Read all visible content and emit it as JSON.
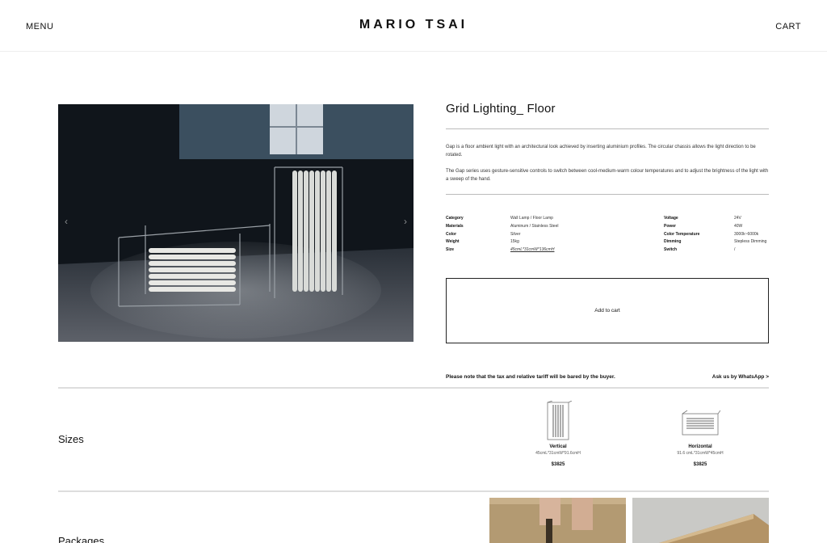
{
  "header": {
    "menu": "MENU",
    "logo": "MARIO TSAI",
    "cart": "CART"
  },
  "product": {
    "title": "Grid Lighting_ Floor",
    "desc1": "Gap is a floor ambient light with an architectural look achieved by inserting aluminium profiles. The circular chassis allows the light direction to be rotated.",
    "desc2": "The Gap series uses gesture-sensitive controls to switch between cool-medium-warm colour temperatures and to adjust the brightness of the light with a sweep of the hand.",
    "specs_left": [
      {
        "label": "Category",
        "value": "Wall Lamp / Floor Lamp"
      },
      {
        "label": "Materials",
        "value": "Aluminum / Stainless Steel"
      },
      {
        "label": "Color",
        "value": "Silver"
      },
      {
        "label": "Weight",
        "value": "15kg"
      },
      {
        "label": "Size",
        "value": "45cmL*31cmW*136cmH"
      }
    ],
    "specs_right": [
      {
        "label": "Voltage",
        "value": "24V"
      },
      {
        "label": "Power",
        "value": "40W"
      },
      {
        "label": "Color Temperature",
        "value": "3000k~6000k"
      },
      {
        "label": "Dimming",
        "value": "Stepless Dimming"
      },
      {
        "label": "Switch",
        "value": "/"
      }
    ],
    "add_to_cart": "Add to cart",
    "note": "Please note that the tax and relative tariff will be bared by the buyer.",
    "whatsapp": "Ask us by WhatsApp >"
  },
  "sizes": {
    "title": "Sizes",
    "options": [
      {
        "name": "Vertical",
        "dims": "45cmL*31cmW*91.6cmH",
        "price": "$3825"
      },
      {
        "name": "Horizontal",
        "dims": "91.6 cmL*31cmW*45cmH",
        "price": "$3825"
      }
    ]
  },
  "packages": {
    "title": "Packages"
  },
  "colors": {
    "accent": "#111111",
    "hero_bg": "#151a20"
  }
}
